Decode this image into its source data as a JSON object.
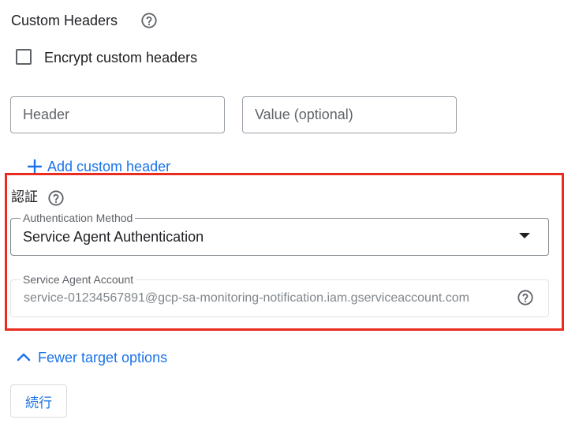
{
  "custom_headers": {
    "title": "Custom Headers",
    "help_icon": "help-circle-icon",
    "encrypt_checkbox": {
      "label": "Encrypt custom headers",
      "checked": false
    },
    "header_input": {
      "placeholder": "Header",
      "value": ""
    },
    "value_input": {
      "placeholder": "Value (optional)",
      "value": ""
    },
    "add_button": {
      "icon": "plus-icon",
      "label": "Add custom header"
    }
  },
  "auth": {
    "label": "認証",
    "help_icon": "help-circle-icon",
    "method_select": {
      "label": "Authentication Method",
      "value": "Service Agent Authentication",
      "icon": "dropdown-arrow-icon"
    },
    "account_field": {
      "label": "Service Agent Account",
      "value": "service-01234567891@gcp-sa-monitoring-notification.iam.gserviceaccount.com",
      "disabled": true,
      "help_icon": "help-circle-icon"
    }
  },
  "fewer_options": {
    "icon": "chevron-up-icon",
    "label": "Fewer target options"
  },
  "continue_button": {
    "label": "続行"
  },
  "colors": {
    "accent": "#1a73e8",
    "highlight_border": "#ea2b1f",
    "text_primary": "#202124",
    "text_secondary": "#5f6368",
    "text_disabled": "#80868b"
  }
}
